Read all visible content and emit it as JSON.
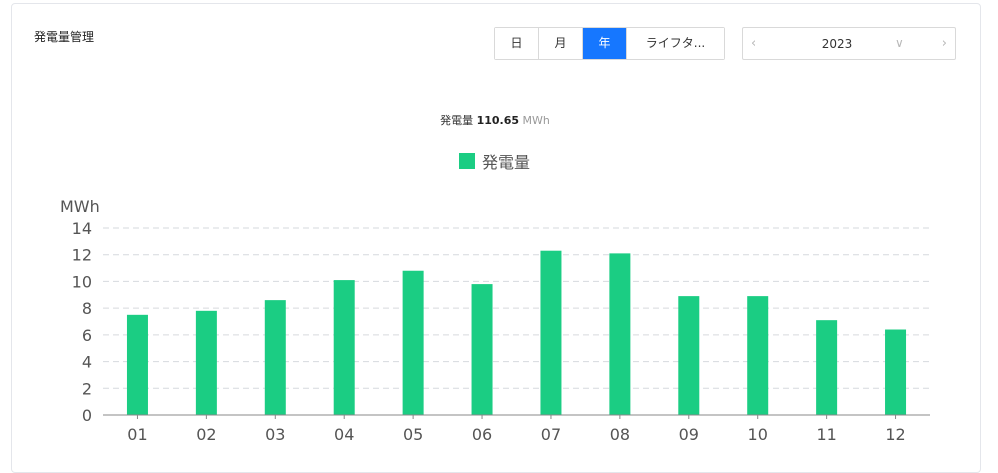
{
  "panel": {
    "title": "発電量管理"
  },
  "period_tabs": [
    {
      "label": "日",
      "active": false
    },
    {
      "label": "月",
      "active": false
    },
    {
      "label": "年",
      "active": true
    },
    {
      "label": "ライフタ...",
      "active": false
    }
  ],
  "date_picker": {
    "value": "2023",
    "prev_icon": "chevron-left-icon",
    "dropdown_icon": "chevron-down-icon",
    "next_icon": "chevron-right-icon"
  },
  "summary": {
    "label": "発電量",
    "value": "110.65",
    "unit": "MWh"
  },
  "colors": {
    "accent": "#1677ff",
    "bar": "#1bcd83"
  },
  "chart_data": {
    "type": "bar",
    "categories": [
      "01",
      "02",
      "03",
      "04",
      "05",
      "06",
      "07",
      "08",
      "09",
      "10",
      "11",
      "12"
    ],
    "series": [
      {
        "name": "発電量",
        "values": [
          7.5,
          7.8,
          8.6,
          10.1,
          10.8,
          9.8,
          12.3,
          12.1,
          8.9,
          8.9,
          7.1,
          6.4
        ]
      }
    ],
    "ylabel": "MWh",
    "ylim": [
      0,
      14
    ],
    "yticks": [
      "0",
      "2",
      "4",
      "6",
      "8",
      "10",
      "12",
      "14"
    ],
    "grid": true,
    "legend_position": "top-center"
  }
}
